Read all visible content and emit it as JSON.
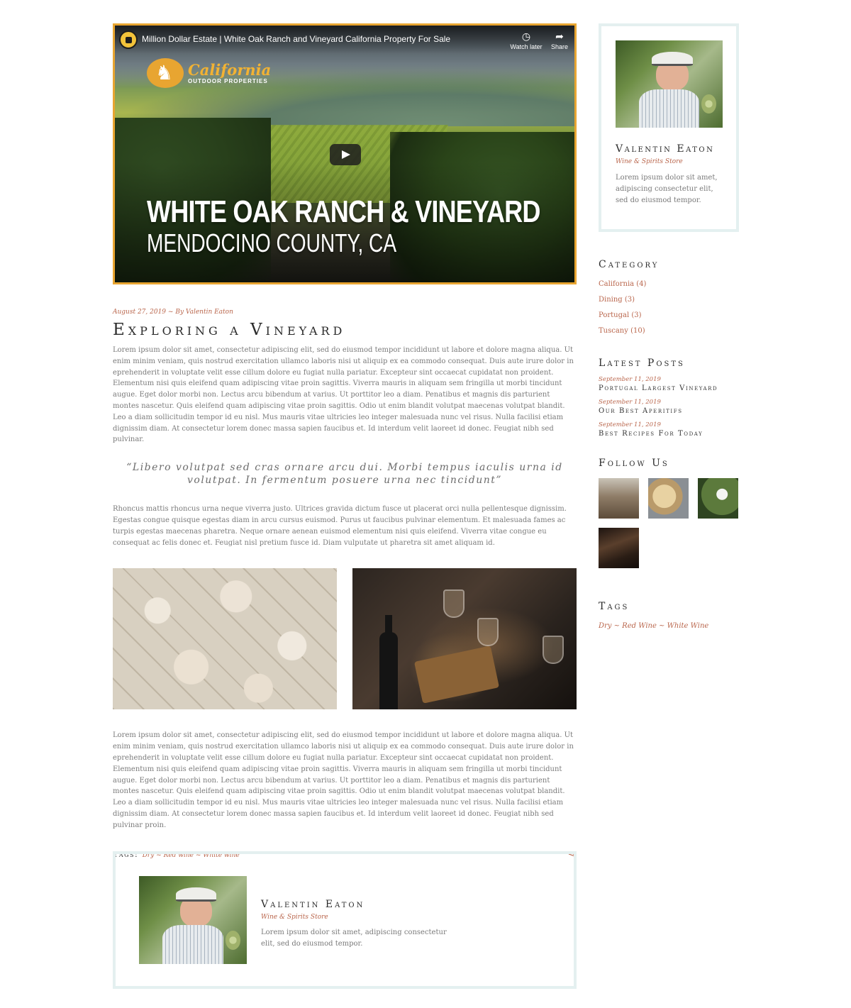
{
  "video": {
    "title": "Million Dollar Estate | White Oak Ranch and Vineyard California Property For Sale",
    "watch_later_label": "Watch later",
    "share_label": "Share",
    "logo_script": "California",
    "logo_sub": "OUTDOOR PROPERTIES",
    "headline": "WHITE OAK RANCH & VINEYARD",
    "subheadline": "MENDOCINO COUNTY, CA"
  },
  "post": {
    "date": "August 27, 2019",
    "separator": "~",
    "author_prefix": "By",
    "author": "Valentin Eaton",
    "title": "Exploring a Vineyard",
    "paragraph1": "Lorem ipsum dolor sit amet, consectetur adipiscing elit, sed do eiusmod tempor incididunt ut labore et dolore magna aliqua. Ut enim minim veniam, quis nostrud exercitation ullamco laboris nisi ut aliquip ex ea commodo consequat. Duis aute irure dolor in eprehenderit in voluptate velit esse cillum dolore eu fugiat nulla pariatur. Excepteur sint occaecat cupidatat non proident. Elementum nisi quis eleifend quam adipiscing vitae proin sagittis. Viverra mauris in aliquam sem fringilla ut morbi tincidunt augue. Eget dolor morbi non. Lectus arcu bibendum at varius. Ut porttitor leo a diam. Penatibus et magnis dis parturient montes nascetur. Quis eleifend quam adipiscing vitae proin sagittis. Odio ut enim blandit volutpat maecenas volutpat blandit. Leo a diam sollicitudin tempor id eu nisl. Mus mauris vitae ultricies leo integer malesuada nunc vel risus. Nulla facilisi etiam dignissim diam. At consectetur lorem donec massa sapien faucibus et. Id interdum velit laoreet id donec. Feugiat nibh sed pulvinar.",
    "quote": "“Libero volutpat sed cras ornare arcu dui. Morbi tempus iaculis urna id volutpat. In fermentum posuere urna nec tincidunt”",
    "paragraph2": "Rhoncus mattis rhoncus urna neque viverra justo. Ultrices gravida dictum fusce ut placerat orci nulla pellentesque dignissim. Egestas congue quisque egestas diam in arcu cursus euismod. Purus ut faucibus pulvinar elementum. Et malesuada fames ac turpis egestas maecenas pharetra. Neque ornare aenean euismod elementum nisi quis eleifend. Viverra vitae congue eu consequat ac felis donec et. Feugiat nisl pretium fusce id. Diam vulputate ut pharetra sit amet aliquam id.",
    "paragraph3": "Lorem ipsum dolor sit amet, consectetur adipiscing elit, sed do eiusmod tempor incididunt ut labore et dolore magna aliqua. Ut enim minim veniam, quis nostrud exercitation ullamco laboris nisi ut aliquip ex ea commodo consequat. Duis aute irure dolor in eprehenderit in voluptate velit esse cillum dolore eu fugiat nulla pariatur. Excepteur sint occaecat cupidatat non proident. Elementum nisi quis eleifend quam adipiscing vitae proin sagittis. Viverra mauris in aliquam sem fringilla ut morbi tincidunt augue. Eget dolor morbi non. Lectus arcu bibendum at varius. Ut porttitor leo a diam. Penatibus et magnis dis parturient montes nascetur. Quis eleifend quam adipiscing vitae proin sagittis. Odio ut enim blandit volutpat maecenas volutpat blandit. Leo a diam sollicitudin tempor id eu nisl. Mus mauris vitae ultricies leo integer malesuada nunc vel risus. Nulla facilisi etiam dignissim diam. At consectetur lorem donec massa sapien faucibus et. Id interdum velit laoreet id donec. Feugiat nibh sed pulvinar proin.",
    "tags_label": "Tags:",
    "tags_value": "Dry ~ Red wine ~ White wine"
  },
  "author_box": {
    "name": "Valentin Eaton",
    "role": "Wine & Spirits Store",
    "bio": "Lorem ipsum dolor sit amet, adipiscing consectetur elit, sed do eiusmod tempor."
  },
  "sidebar": {
    "profile": {
      "name": "Valentin Eaton",
      "role": "Wine & Spirits Store",
      "bio": "Lorem ipsum dolor sit amet, adipiscing consectetur elit, sed do eiusmod tempor."
    },
    "category_title": "Category",
    "categories": [
      {
        "label": "California (4)"
      },
      {
        "label": "Dining (3)"
      },
      {
        "label": "Portugal (3)"
      },
      {
        "label": "Tuscany (10)"
      }
    ],
    "latest_title": "Latest Posts",
    "latest_posts": [
      {
        "date": "September 11, 2019",
        "title": "Portugal Largest Vineyard"
      },
      {
        "date": "September 11, 2019",
        "title": "Our Best Aperitifs"
      },
      {
        "date": "September 11, 2019",
        "title": "Best Recipes For Today"
      }
    ],
    "follow_title": "Follow Us",
    "tags_title": "Tags",
    "tags_value": "Dry ~ Red Wine ~ White Wine"
  },
  "colors": {
    "accent": "#b9654b",
    "video_border": "#e8a531",
    "box_border": "#e4f0f0"
  }
}
